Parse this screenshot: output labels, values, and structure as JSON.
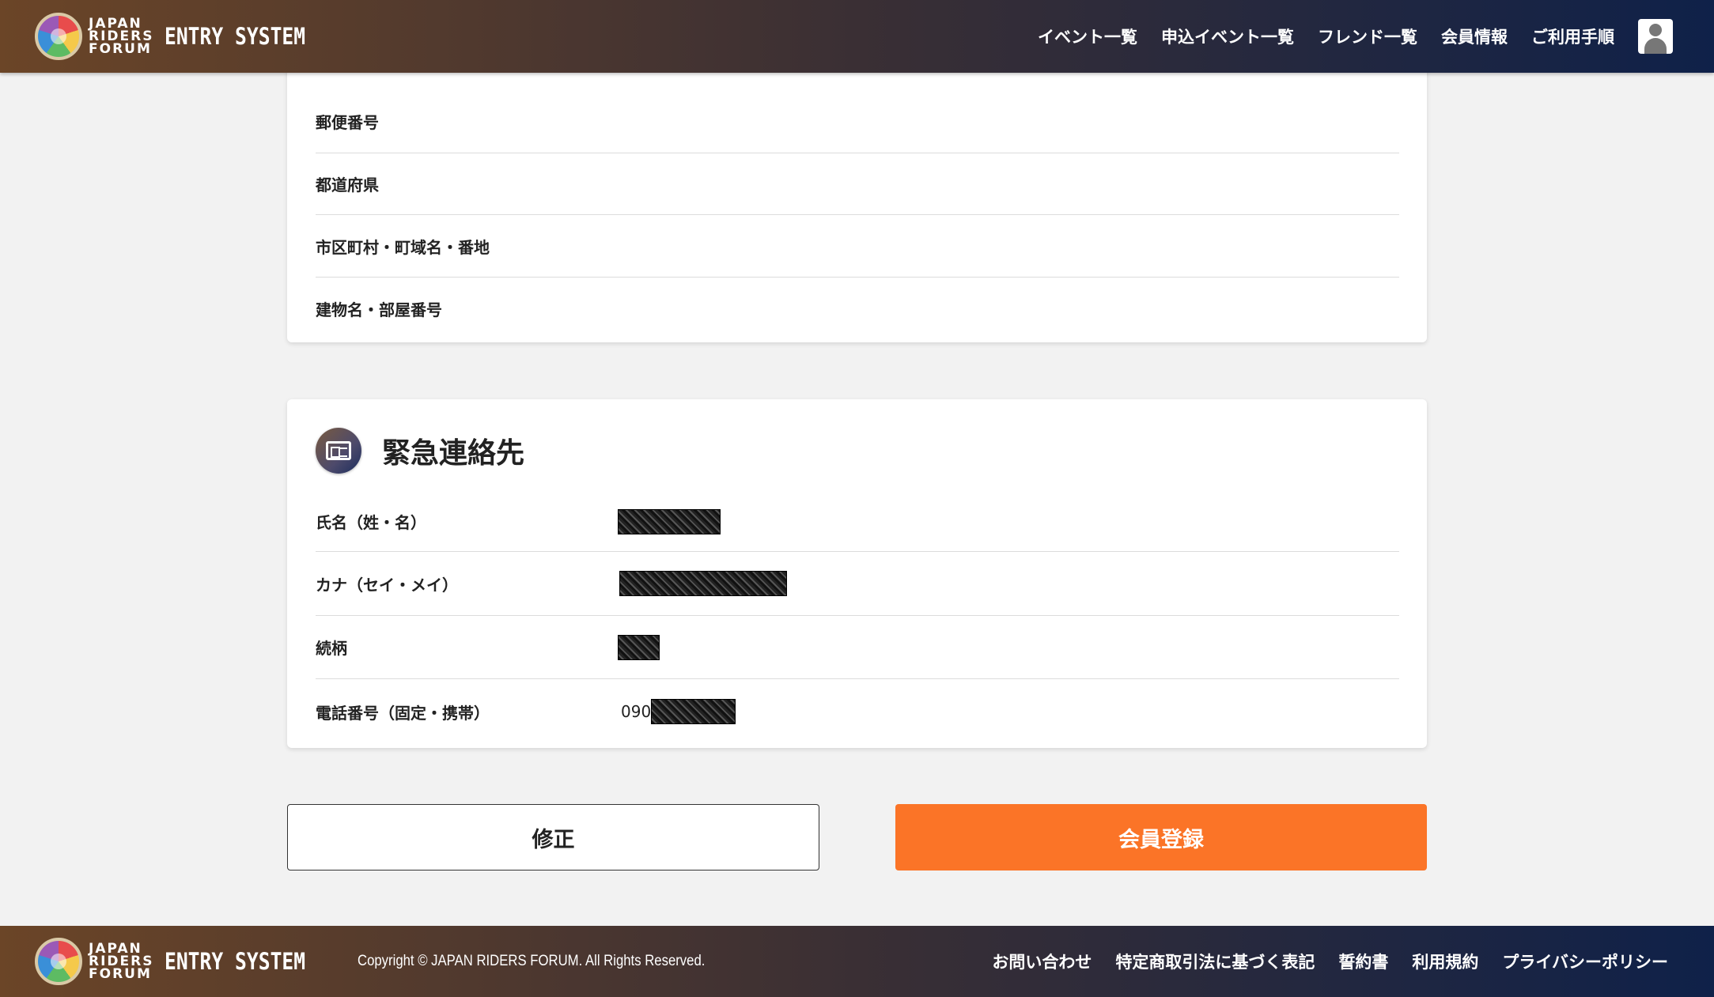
{
  "header": {
    "brand_line1": "JAPAN",
    "brand_line2": "RIDERS",
    "brand_line3": "FORUM",
    "brand_system": "ENTRY SYSTEM",
    "nav": [
      "イベント一覧",
      "申込イベント一覧",
      "フレンド一覧",
      "会員情報",
      "ご利用手順"
    ],
    "avatar_icon": "user-avatar-icon"
  },
  "address_card": {
    "rows": [
      {
        "label": "郵便番号",
        "value": ""
      },
      {
        "label": "都道府県",
        "value": ""
      },
      {
        "label": "市区町村・町域名・番地",
        "value": ""
      },
      {
        "label": "建物名・部屋番号",
        "value": ""
      }
    ]
  },
  "emergency_card": {
    "title": "緊急連絡先",
    "icon": "id-card-icon",
    "rows": [
      {
        "label": "氏名（姓・名）",
        "value": ""
      },
      {
        "label": "カナ（セイ・メイ）",
        "value": ""
      },
      {
        "label": "続柄",
        "value": ""
      },
      {
        "label": "電話番号（固定・携帯）",
        "value": "090"
      }
    ]
  },
  "buttons": {
    "edit": "修正",
    "register": "会員登録",
    "register_color": "#fb7427"
  },
  "footer": {
    "copyright": "Copyright © JAPAN RIDERS FORUM. All Rights Reserved.",
    "links": [
      "お問い合わせ",
      "特定商取引法に基づく表記",
      "誓約書",
      "利用規約",
      "プライバシーポリシー"
    ]
  }
}
